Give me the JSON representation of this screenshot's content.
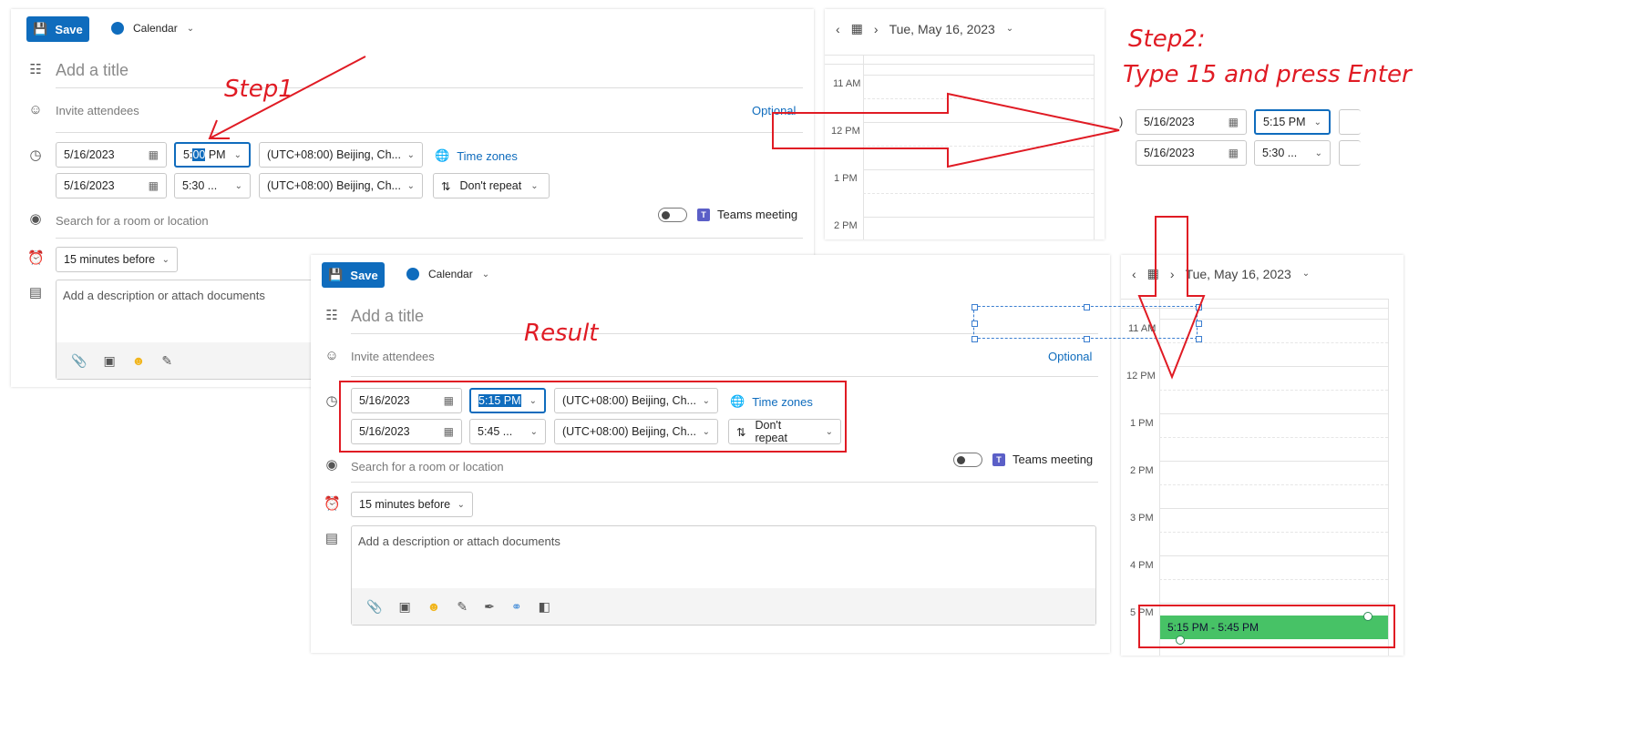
{
  "step1": {
    "save_label": "Save",
    "calendar_label": "Calendar",
    "title_placeholder": "Add a title",
    "attendees_placeholder": "Invite attendees",
    "optional_label": "Optional",
    "start_date": "5/16/2023",
    "start_time_selected": "5:00",
    "start_time_prefix": "5:",
    "start_time_highlight": "00",
    "start_time_suffix": " PM",
    "end_date": "5/16/2023",
    "end_time": "5:30 ...",
    "timezone": "(UTC+08:00) Beijing, Ch...",
    "time_zones_link": "Time zones",
    "repeat_label": "Don't repeat",
    "location_placeholder": "Search for a room or location",
    "teams_label": "Teams meeting",
    "reminder": "15 minutes before",
    "description_placeholder": "Add a description or attach documents",
    "annotation": "Step1"
  },
  "top_calendar": {
    "date_label": "Tue, May 16, 2023",
    "hours": [
      "11 AM",
      "12 PM",
      "1 PM",
      "2 PM"
    ]
  },
  "step2": {
    "annotation_line1": "Step2:",
    "annotation_line2": "Type 15 and press Enter",
    "start_date": "5/16/2023",
    "start_time": "5:15 PM",
    "end_date": "5/16/2023",
    "end_time": "5:30 ..."
  },
  "result": {
    "annotation": "Result",
    "save_label": "Save",
    "calendar_label": "Calendar",
    "title_placeholder": "Add a title",
    "attendees_placeholder": "Invite attendees",
    "optional_label": "Optional",
    "start_date": "5/16/2023",
    "start_time": "5:15 PM",
    "end_date": "5/16/2023",
    "end_time": "5:45 ...",
    "timezone": "(UTC+08:00) Beijing, Ch...",
    "time_zones_link": "Time zones",
    "repeat_label": "Don't repeat",
    "location_placeholder": "Search for a room or location",
    "teams_label": "Teams meeting",
    "reminder": "15 minutes before",
    "description_placeholder": "Add a description or attach documents"
  },
  "result_calendar": {
    "date_label": "Tue, May 16, 2023",
    "hours": [
      "11 AM",
      "12 PM",
      "1 PM",
      "2 PM",
      "3 PM",
      "4 PM",
      "5 PM"
    ],
    "event_label": "5:15 PM - 5:45 PM",
    "event_color": "#47c266"
  },
  "colors": {
    "accent": "#0f6cbd",
    "annotation": "#e01b24"
  },
  "icons": [
    "save-icon",
    "calendar-dot-icon",
    "chevron-down-icon",
    "title-icon",
    "attendees-icon",
    "clock-icon",
    "date-picker-icon",
    "globe-icon",
    "repeat-icon",
    "location-icon",
    "teams-icon",
    "alarm-icon",
    "description-icon",
    "attach-icon",
    "image-icon",
    "emoji-icon",
    "format-icon",
    "signature-icon",
    "loop-icon",
    "template-icon",
    "prev-arrow-icon",
    "next-arrow-icon",
    "today-icon"
  ]
}
